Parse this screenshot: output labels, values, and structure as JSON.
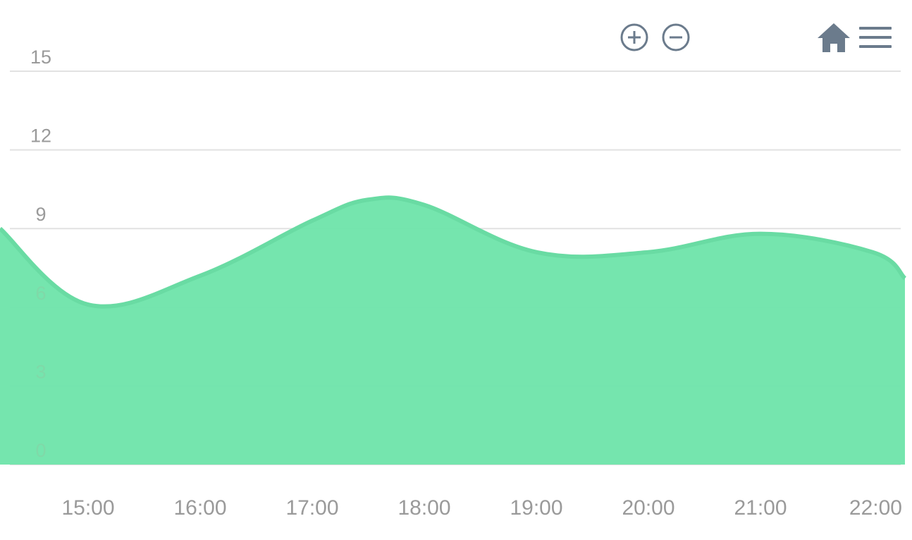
{
  "chart_data": {
    "type": "area",
    "x": [
      "14:00",
      "15:00",
      "16:00",
      "17:00",
      "17:30",
      "18:00",
      "19:00",
      "20:00",
      "21:00",
      "22:00",
      "22:30"
    ],
    "series": [
      {
        "values": [
          9,
          6.1,
          7.2,
          9.3,
          10.1,
          9.9,
          8.1,
          8.1,
          8.8,
          8.1,
          7.1
        ],
        "color": "#6ee4aa"
      }
    ],
    "x_tick_labels": [
      "15:00",
      "16:00",
      "17:00",
      "18:00",
      "19:00",
      "20:00",
      "21:00",
      "22:00"
    ],
    "y_tick_labels": [
      "0",
      "3",
      "6",
      "9",
      "12",
      "15"
    ],
    "ylim": [
      0,
      15
    ],
    "grid": true,
    "legend": "none"
  },
  "toolbar": {
    "zoom_in_icon": "zoom-in-icon",
    "zoom_out_icon": "zoom-out-icon",
    "home_icon": "home-icon",
    "menu_icon": "menu-icon",
    "icon_color": "#6b7b8c"
  }
}
